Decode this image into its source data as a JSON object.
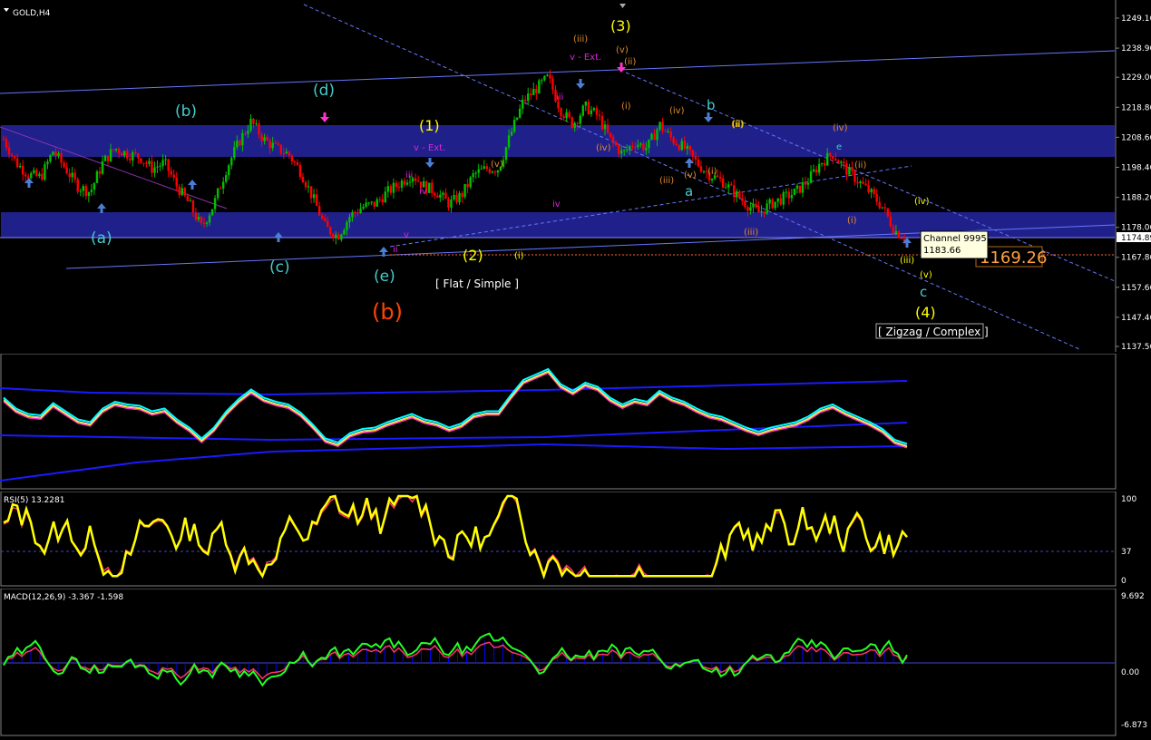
{
  "colors": {
    "background": "#000000",
    "bull_candle": "#00c000",
    "bear_candle": "#ff0000",
    "channel_band": "#2020a0",
    "channel_line": "#6677ff",
    "wave_cyan": "#44cccc",
    "wave_yellow": "#ffff00",
    "wave_orange": "#e08a30",
    "wave_magenta": "#dd22dd",
    "wave_red": "#ff4400",
    "rsi_line": "#ffff00",
    "macd_main": "#22ff22",
    "macd_signal": "#ff3366",
    "macd_hist": "#0000ff"
  },
  "header": {
    "symbol_label": "GOLD,H4",
    "dropdown_icon": "triangle-down-icon"
  },
  "chart_data": [
    {
      "type": "candlestick",
      "title": "GOLD,H4",
      "y_ticks": [
        "1249.16",
        "1238.96",
        "1229.06",
        "1218.86",
        "1208.66",
        "1198.46",
        "1188.26",
        "1178.06",
        "1167.86",
        "1157.66",
        "1147.46",
        "1137.56"
      ],
      "ylim": [
        1137.56,
        1249.16
      ],
      "price_tag": "1174.89",
      "big_price": "1169.26",
      "channel_tooltip": {
        "name": "Channel 9995",
        "value": "1183.66"
      },
      "close_path": [
        1208,
        1200,
        1196,
        1195,
        1204,
        1198,
        1192,
        1190,
        1200,
        1205,
        1203,
        1202,
        1198,
        1200,
        1192,
        1186,
        1178,
        1186,
        1198,
        1207,
        1214,
        1208,
        1205,
        1203,
        1197,
        1188,
        1178,
        1175,
        1182,
        1185,
        1186,
        1190,
        1193,
        1196,
        1192,
        1190,
        1186,
        1189,
        1196,
        1198,
        1198,
        1210,
        1221,
        1225,
        1229,
        1218,
        1213,
        1219,
        1216,
        1208,
        1203,
        1207,
        1205,
        1213,
        1208,
        1205,
        1200,
        1196,
        1194,
        1190,
        1186,
        1183,
        1186,
        1188,
        1190,
        1194,
        1200,
        1203,
        1198,
        1194,
        1190,
        1185,
        1177,
        1174
      ],
      "wave_labels": [
        {
          "text": "(a)",
          "color": "cyan"
        },
        {
          "text": "(b)",
          "color": "cyan"
        },
        {
          "text": "(c)",
          "color": "cyan"
        },
        {
          "text": "(d)",
          "color": "cyan"
        },
        {
          "text": "(e)",
          "color": "cyan"
        },
        {
          "text": "(b)",
          "color": "red"
        },
        {
          "text": "(1)",
          "color": "yellow"
        },
        {
          "text": "(2)",
          "color": "yellow"
        },
        {
          "text": "(3)",
          "color": "yellow"
        },
        {
          "text": "(4)",
          "color": "yellow"
        },
        {
          "text": "a",
          "color": "cyan"
        },
        {
          "text": "b",
          "color": "cyan"
        },
        {
          "text": "c",
          "color": "cyan"
        },
        {
          "text": "v - Ext.",
          "color": "magenta"
        },
        {
          "text": "v - Ext.",
          "color": "magenta"
        },
        {
          "text": "(iii)",
          "color": "orange"
        },
        {
          "text": "(v)",
          "color": "orange"
        },
        {
          "text": "(ii)",
          "color": "orange"
        },
        {
          "text": "(i)",
          "color": "orange"
        },
        {
          "text": "(iv)",
          "color": "orange"
        },
        {
          "text": "(iv)",
          "color": "orange"
        },
        {
          "text": "(v)",
          "color": "orange"
        },
        {
          "text": "(iii)",
          "color": "orange"
        },
        {
          "text": "(i)",
          "color": "orange"
        },
        {
          "text": "(ii)",
          "color": "orange"
        },
        {
          "text": "(i)",
          "color": "orange"
        },
        {
          "text": "(ii)",
          "color": "orange"
        },
        {
          "text": "(iii)",
          "color": "orange"
        },
        {
          "text": "(iv)",
          "color": "orange"
        },
        {
          "text": "(i)",
          "color": "yellow"
        },
        {
          "text": "(ii)",
          "color": "yellow"
        },
        {
          "text": "(iii)",
          "color": "yellow"
        },
        {
          "text": "(iv)",
          "color": "yellow"
        },
        {
          "text": "(v)",
          "color": "yellow"
        },
        {
          "text": "(v)",
          "color": "orange"
        },
        {
          "text": "e",
          "color": "cyan"
        },
        {
          "text": "iii",
          "color": "magenta"
        },
        {
          "text": "iv",
          "color": "magenta"
        },
        {
          "text": "v",
          "color": "magenta"
        },
        {
          "text": "ii",
          "color": "magenta"
        },
        {
          "text": "iii",
          "color": "magenta"
        },
        {
          "text": "iv",
          "color": "magenta"
        }
      ],
      "annotations": [
        "[ Flat / Simple ]",
        "[ Zigzag / Complex ]"
      ]
    },
    {
      "type": "line",
      "title": "",
      "note": "moving average envelope panel"
    },
    {
      "type": "line",
      "title": "RSI(5) 13.2281",
      "y_ticks": [
        "100",
        "37",
        "0"
      ],
      "ylim": [
        0,
        100
      ],
      "level": 37
    },
    {
      "type": "bar",
      "title": "MACD(12,26,9) -3.367 -1.598",
      "y_ticks": [
        "9.692",
        "0.00",
        "-6.873"
      ],
      "ylim": [
        -6.873,
        9.692
      ]
    }
  ],
  "pane_titles": {
    "rsi": "RSI(5) 13.2281",
    "macd": "MACD(12,26,9) -3.367 -1.598"
  }
}
